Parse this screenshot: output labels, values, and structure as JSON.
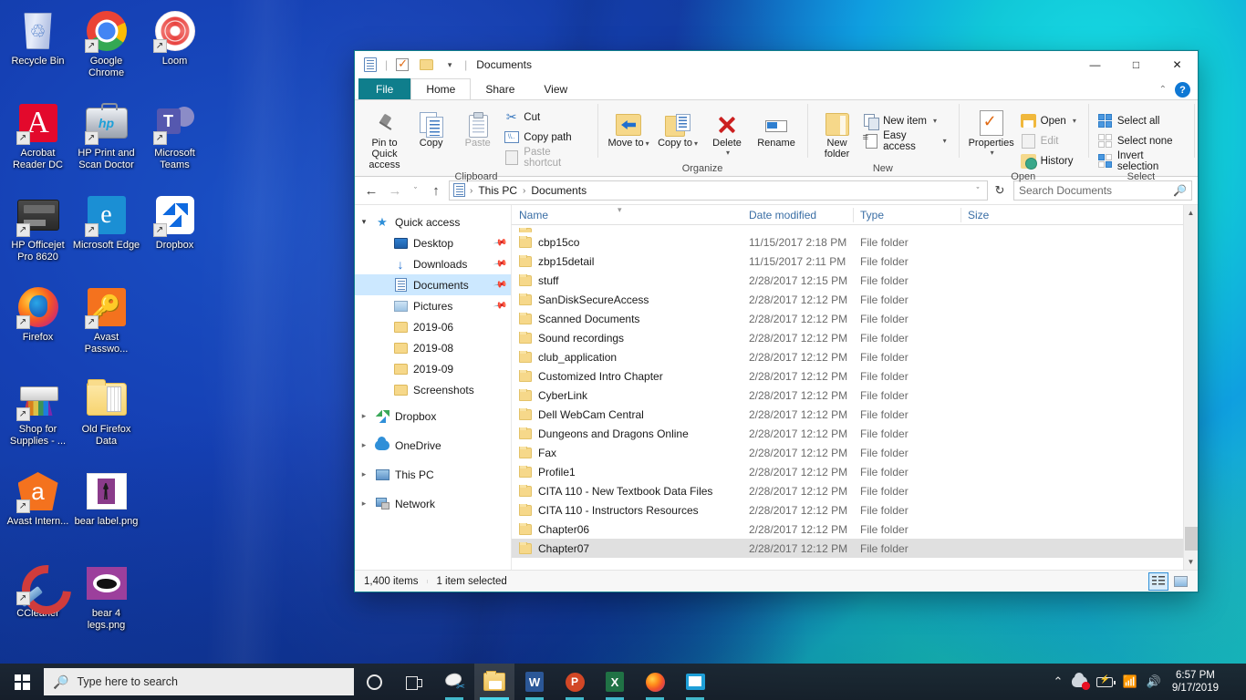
{
  "desktop": {
    "icons": [
      {
        "label": "Recycle Bin",
        "icon": "recycle-bin-icon",
        "shortcut": false
      },
      {
        "label": "Google Chrome",
        "icon": "chrome-icon",
        "shortcut": true
      },
      {
        "label": "Loom",
        "icon": "loom-icon",
        "shortcut": true
      },
      {
        "label": "Acrobat Reader DC",
        "icon": "acrobat-reader-icon",
        "shortcut": true
      },
      {
        "label": "HP Print and Scan Doctor",
        "icon": "hp-print-scan-doctor-icon",
        "shortcut": true
      },
      {
        "label": "Microsoft Teams",
        "icon": "microsoft-teams-icon",
        "shortcut": true
      },
      {
        "label": "HP Officejet Pro 8620",
        "icon": "hp-officejet-printer-icon",
        "shortcut": true
      },
      {
        "label": "Microsoft Edge",
        "icon": "microsoft-edge-icon",
        "shortcut": true
      },
      {
        "label": "Dropbox",
        "icon": "dropbox-icon",
        "shortcut": true
      },
      {
        "label": "Firefox",
        "icon": "firefox-icon",
        "shortcut": true
      },
      {
        "label": "Avast Passwo...",
        "icon": "avast-passwords-icon",
        "shortcut": true
      },
      {
        "label": "Shop for Supplies - ...",
        "icon": "shop-supplies-icon",
        "shortcut": true
      },
      {
        "label": "Old Firefox Data",
        "icon": "folder-icon",
        "shortcut": false
      },
      {
        "label": "Avast Intern...",
        "icon": "avast-antivirus-icon",
        "shortcut": true
      },
      {
        "label": "bear label.png",
        "icon": "image-file-icon",
        "shortcut": false
      },
      {
        "label": "CCleaner",
        "icon": "ccleaner-icon",
        "shortcut": true
      },
      {
        "label": "bear 4 legs.png",
        "icon": "image-file-icon",
        "shortcut": false
      }
    ]
  },
  "explorer": {
    "title": "Documents",
    "quick_access_toolbar": [
      {
        "name": "properties-qat-icon"
      },
      {
        "name": "new-folder-qat-icon"
      },
      {
        "name": "folder-qat-icon"
      },
      {
        "name": "customize-qat-chevron"
      }
    ],
    "window_controls": {
      "minimize": "—",
      "maximize": "□",
      "close": "✕"
    },
    "ribbon_collapse": "⌃",
    "help": "?",
    "tabs": [
      {
        "label": "File",
        "active": false
      },
      {
        "label": "Home",
        "active": true
      },
      {
        "label": "Share",
        "active": false
      },
      {
        "label": "View",
        "active": false
      }
    ],
    "ribbon": {
      "groups": [
        {
          "label": "Clipboard",
          "big": [
            {
              "label": "Pin to Quick access",
              "icon": "pin-icon",
              "disabled": false
            },
            {
              "label": "Copy",
              "icon": "copy-icon",
              "disabled": false
            },
            {
              "label": "Paste",
              "icon": "paste-icon",
              "disabled": true
            }
          ],
          "small": [
            {
              "label": "Cut",
              "icon": "cut-icon",
              "disabled": false
            },
            {
              "label": "Copy path",
              "icon": "copy-path-icon",
              "disabled": false
            },
            {
              "label": "Paste shortcut",
              "icon": "paste-shortcut-icon",
              "disabled": true
            }
          ]
        },
        {
          "label": "Organize",
          "big": [
            {
              "label": "Move to",
              "icon": "move-to-icon",
              "dropdown": true
            },
            {
              "label": "Copy to",
              "icon": "copy-to-icon",
              "dropdown": true
            },
            {
              "label": "Delete",
              "icon": "delete-icon",
              "dropdown": true
            },
            {
              "label": "Rename",
              "icon": "rename-icon",
              "dropdown": false
            }
          ],
          "small": []
        },
        {
          "label": "New",
          "big": [
            {
              "label": "New folder",
              "icon": "new-folder-icon",
              "disabled": false
            }
          ],
          "small": [
            {
              "label": "New item",
              "icon": "new-item-icon",
              "dropdown": true
            },
            {
              "label": "Easy access",
              "icon": "easy-access-icon",
              "dropdown": true
            }
          ]
        },
        {
          "label": "Open",
          "big": [
            {
              "label": "Properties",
              "icon": "properties-icon",
              "dropdown": true
            }
          ],
          "small": [
            {
              "label": "Open",
              "icon": "open-icon",
              "dropdown": true
            },
            {
              "label": "Edit",
              "icon": "edit-icon",
              "disabled": true
            },
            {
              "label": "History",
              "icon": "history-icon",
              "disabled": false
            }
          ]
        },
        {
          "label": "Select",
          "big": [],
          "small": [
            {
              "label": "Select all",
              "icon": "select-all-icon"
            },
            {
              "label": "Select none",
              "icon": "select-none-icon"
            },
            {
              "label": "Invert selection",
              "icon": "invert-selection-icon"
            }
          ]
        }
      ]
    },
    "address": {
      "back": "←",
      "forward": "→",
      "recent": "ˇ",
      "up": "↑",
      "breadcrumbs": [
        "This PC",
        "Documents"
      ],
      "separator": "›",
      "dropdown": "ˇ",
      "refresh": "↻"
    },
    "search": {
      "placeholder": "Search Documents",
      "value": "",
      "icon": "search-icon"
    },
    "nav_pane": [
      {
        "label": "Quick access",
        "icon": "quick-access-star-icon",
        "level": 1,
        "twisty": "open",
        "pinned": false,
        "selected": false
      },
      {
        "label": "Desktop",
        "icon": "desktop-icon",
        "level": 2,
        "twisty": "none",
        "pinned": true,
        "selected": false
      },
      {
        "label": "Downloads",
        "icon": "downloads-icon",
        "level": 2,
        "twisty": "none",
        "pinned": true,
        "selected": false
      },
      {
        "label": "Documents",
        "icon": "documents-icon",
        "level": 2,
        "twisty": "none",
        "pinned": true,
        "selected": true
      },
      {
        "label": "Pictures",
        "icon": "pictures-icon",
        "level": 2,
        "twisty": "none",
        "pinned": true,
        "selected": false
      },
      {
        "label": "2019-06",
        "icon": "folder-icon",
        "level": 2,
        "twisty": "none",
        "pinned": false,
        "selected": false
      },
      {
        "label": "2019-08",
        "icon": "folder-icon",
        "level": 2,
        "twisty": "none",
        "pinned": false,
        "selected": false
      },
      {
        "label": "2019-09",
        "icon": "folder-icon",
        "level": 2,
        "twisty": "none",
        "pinned": false,
        "selected": false
      },
      {
        "label": "Screenshots",
        "icon": "folder-icon",
        "level": 2,
        "twisty": "none",
        "pinned": false,
        "selected": false
      },
      {
        "label": "Dropbox",
        "icon": "dropbox-icon",
        "level": 1,
        "twisty": "closed",
        "pinned": false,
        "selected": false
      },
      {
        "label": "OneDrive",
        "icon": "onedrive-cloud-icon",
        "level": 1,
        "twisty": "closed",
        "pinned": false,
        "selected": false
      },
      {
        "label": "This PC",
        "icon": "this-pc-icon",
        "level": 1,
        "twisty": "closed",
        "pinned": false,
        "selected": false
      },
      {
        "label": "Network",
        "icon": "network-icon",
        "level": 1,
        "twisty": "closed",
        "pinned": false,
        "selected": false
      }
    ],
    "columns": [
      {
        "label": "Name",
        "sorted": true
      },
      {
        "label": "Date modified",
        "sorted": false
      },
      {
        "label": "Type",
        "sorted": false
      },
      {
        "label": "Size",
        "sorted": false
      }
    ],
    "files": [
      {
        "name": "cbp15co",
        "date": "11/15/2017 2:18 PM",
        "type": "File folder",
        "size": "",
        "selected": false
      },
      {
        "name": "zbp15detail",
        "date": "11/15/2017 2:11 PM",
        "type": "File folder",
        "size": "",
        "selected": false
      },
      {
        "name": "stuff",
        "date": "2/28/2017 12:15 PM",
        "type": "File folder",
        "size": "",
        "selected": false
      },
      {
        "name": "SanDiskSecureAccess",
        "date": "2/28/2017 12:12 PM",
        "type": "File folder",
        "size": "",
        "selected": false
      },
      {
        "name": "Scanned Documents",
        "date": "2/28/2017 12:12 PM",
        "type": "File folder",
        "size": "",
        "selected": false
      },
      {
        "name": "Sound recordings",
        "date": "2/28/2017 12:12 PM",
        "type": "File folder",
        "size": "",
        "selected": false
      },
      {
        "name": "club_application",
        "date": "2/28/2017 12:12 PM",
        "type": "File folder",
        "size": "",
        "selected": false
      },
      {
        "name": "Customized Intro Chapter",
        "date": "2/28/2017 12:12 PM",
        "type": "File folder",
        "size": "",
        "selected": false
      },
      {
        "name": "CyberLink",
        "date": "2/28/2017 12:12 PM",
        "type": "File folder",
        "size": "",
        "selected": false
      },
      {
        "name": "Dell WebCam Central",
        "date": "2/28/2017 12:12 PM",
        "type": "File folder",
        "size": "",
        "selected": false
      },
      {
        "name": "Dungeons and Dragons Online",
        "date": "2/28/2017 12:12 PM",
        "type": "File folder",
        "size": "",
        "selected": false
      },
      {
        "name": "Fax",
        "date": "2/28/2017 12:12 PM",
        "type": "File folder",
        "size": "",
        "selected": false
      },
      {
        "name": "Profile1",
        "date": "2/28/2017 12:12 PM",
        "type": "File folder",
        "size": "",
        "selected": false
      },
      {
        "name": "CITA 110 - New Textbook Data Files",
        "date": "2/28/2017 12:12 PM",
        "type": "File folder",
        "size": "",
        "selected": false
      },
      {
        "name": "CITA 110 - Instructors Resources",
        "date": "2/28/2017 12:12 PM",
        "type": "File folder",
        "size": "",
        "selected": false
      },
      {
        "name": "Chapter06",
        "date": "2/28/2017 12:12 PM",
        "type": "File folder",
        "size": "",
        "selected": false
      },
      {
        "name": "Chapter07",
        "date": "2/28/2017 12:12 PM",
        "type": "File folder",
        "size": "",
        "selected": true
      }
    ],
    "status": {
      "item_count": "1,400 items",
      "selection": "1 item selected"
    },
    "view_buttons": [
      {
        "name": "details-view-button",
        "active": true
      },
      {
        "name": "large-icons-view-button",
        "active": false
      }
    ]
  },
  "taskbar": {
    "start": "start-button",
    "search_placeholder": "Type here to search",
    "search_icon": "search-icon",
    "buttons": [
      {
        "name": "cortana-button",
        "state": "idle"
      },
      {
        "name": "task-view-button",
        "state": "idle"
      },
      {
        "name": "snip-sketch-button",
        "state": "running"
      },
      {
        "name": "file-explorer-button",
        "state": "active"
      },
      {
        "name": "word-button",
        "state": "running",
        "letter": "W"
      },
      {
        "name": "powerpoint-button",
        "state": "running",
        "letter": "P"
      },
      {
        "name": "excel-button",
        "state": "running",
        "letter": "X"
      },
      {
        "name": "firefox-button",
        "state": "running"
      },
      {
        "name": "publisher-button",
        "state": "running"
      }
    ],
    "tray": [
      {
        "name": "show-hidden-icons-chevron",
        "glyph": "⌃"
      },
      {
        "name": "onedrive-error-icon"
      },
      {
        "name": "battery-icon"
      },
      {
        "name": "wifi-icon",
        "glyph": "◠"
      },
      {
        "name": "volume-icon",
        "glyph": "🔊"
      }
    ],
    "clock": {
      "time": "6:57 PM",
      "date": "9/17/2019"
    }
  },
  "colors": {
    "accent_teal": "#0f7e8c",
    "selection_blue": "#cce8ff",
    "row_selected_gray": "#e0e0e0",
    "taskbar": "#1f2b33",
    "column_header_text": "#3a6ea5"
  }
}
